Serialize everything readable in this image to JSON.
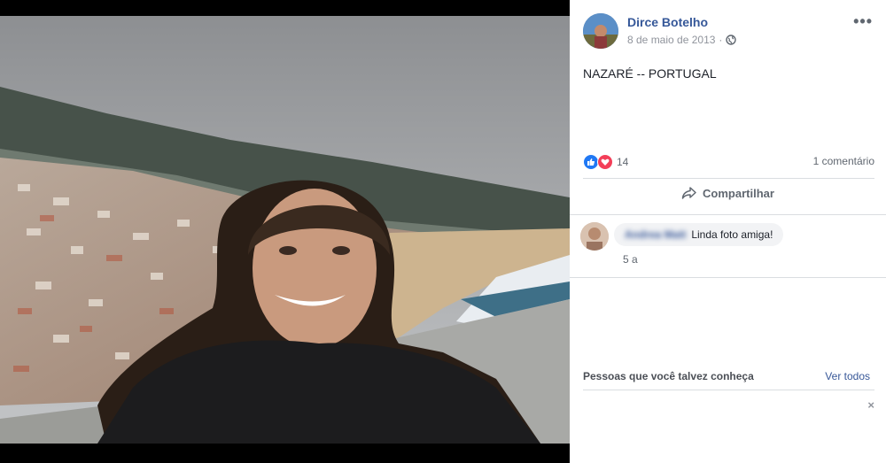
{
  "post": {
    "author": "Dirce Botelho",
    "date": "8 de maio de 2013",
    "separator": "·",
    "privacy_icon": "globe-icon",
    "more_label": "•••",
    "caption": "NAZARÉ -- PORTUGAL"
  },
  "reactions": {
    "icons": [
      "like-icon",
      "love-icon"
    ],
    "count": "14",
    "comments_label": "1 comentário"
  },
  "actions": {
    "share_label": "Compartilhar"
  },
  "comments": [
    {
      "author": "Andrea Matt",
      "text": "Linda foto amiga!",
      "time": "5 a"
    }
  ],
  "pymk": {
    "title": "Pessoas que você talvez conheça",
    "see_all": "Ver todos",
    "close": "×"
  },
  "colors": {
    "link": "#365899",
    "like": "#2078f4",
    "love": "#f33e58"
  }
}
